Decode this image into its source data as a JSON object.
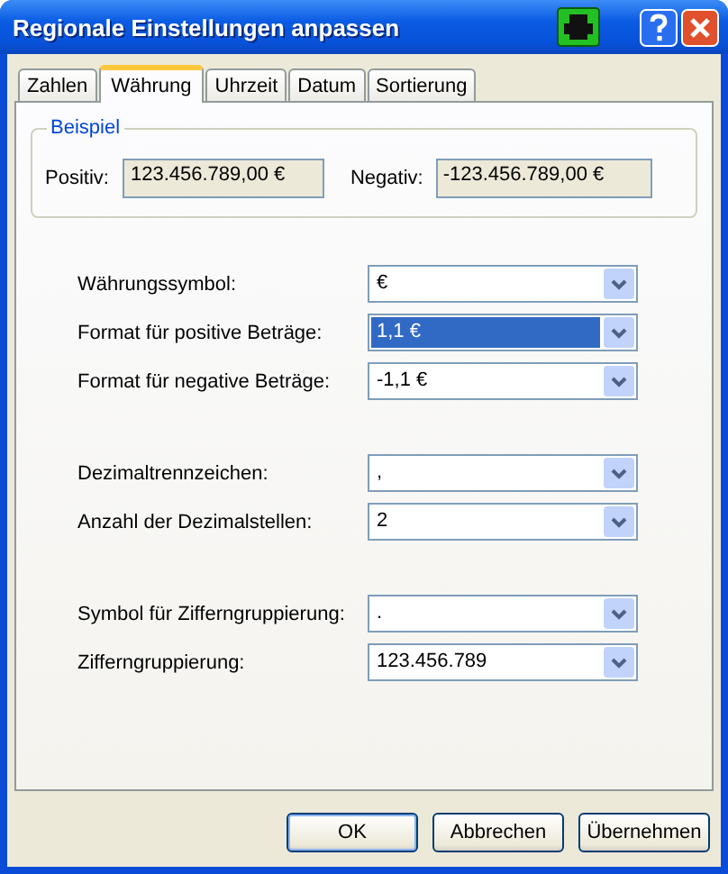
{
  "window": {
    "title": "Regionale Einstellungen anpassen"
  },
  "tabs": [
    {
      "label": "Zahlen",
      "selected": false
    },
    {
      "label": "Währung",
      "selected": true
    },
    {
      "label": "Uhrzeit",
      "selected": false
    },
    {
      "label": "Datum",
      "selected": false
    },
    {
      "label": "Sortierung",
      "selected": false
    }
  ],
  "example": {
    "title": "Beispiel",
    "positive_label": "Positiv:",
    "positive_value": "123.456.789,00 €",
    "negative_label": "Negativ:",
    "negative_value": "-123.456.789,00 €"
  },
  "sections": [
    {
      "rows": [
        {
          "label": "Währungssymbol:",
          "value": "€",
          "highlighted": false
        },
        {
          "label": "Format für positive Beträge:",
          "value": "1,1 €",
          "highlighted": true
        },
        {
          "label": "Format für negative Beträge:",
          "value": "-1,1 €",
          "highlighted": false
        }
      ]
    },
    {
      "rows": [
        {
          "label": "Dezimaltrennzeichen:",
          "value": ",",
          "highlighted": false
        },
        {
          "label": "Anzahl der Dezimalstellen:",
          "value": "2",
          "highlighted": false
        }
      ]
    },
    {
      "rows": [
        {
          "label": "Symbol für Zifferngruppierung:",
          "value": ".",
          "highlighted": false
        },
        {
          "label": "Zifferngruppierung:",
          "value": "123.456.789",
          "highlighted": false
        }
      ]
    }
  ],
  "buttons": [
    {
      "label": "OK",
      "default": true
    },
    {
      "label": "Abbrechen",
      "default": false
    },
    {
      "label": "Übernehmen",
      "default": false
    }
  ]
}
